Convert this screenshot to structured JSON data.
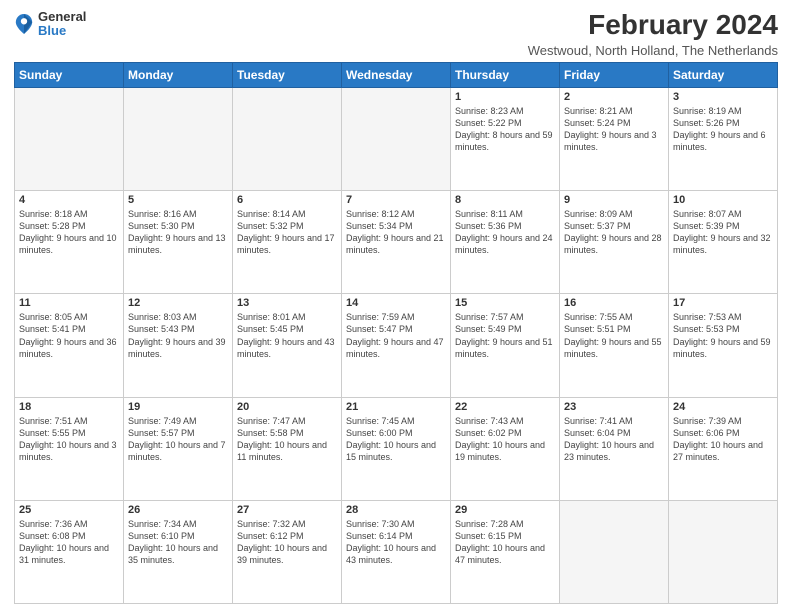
{
  "logo": {
    "general": "General",
    "blue": "Blue"
  },
  "title": "February 2024",
  "subtitle": "Westwoud, North Holland, The Netherlands",
  "days_header": [
    "Sunday",
    "Monday",
    "Tuesday",
    "Wednesday",
    "Thursday",
    "Friday",
    "Saturday"
  ],
  "weeks": [
    [
      {
        "day": "",
        "info": ""
      },
      {
        "day": "",
        "info": ""
      },
      {
        "day": "",
        "info": ""
      },
      {
        "day": "",
        "info": ""
      },
      {
        "day": "1",
        "info": "Sunrise: 8:23 AM\nSunset: 5:22 PM\nDaylight: 8 hours\nand 59 minutes."
      },
      {
        "day": "2",
        "info": "Sunrise: 8:21 AM\nSunset: 5:24 PM\nDaylight: 9 hours\nand 3 minutes."
      },
      {
        "day": "3",
        "info": "Sunrise: 8:19 AM\nSunset: 5:26 PM\nDaylight: 9 hours\nand 6 minutes."
      }
    ],
    [
      {
        "day": "4",
        "info": "Sunrise: 8:18 AM\nSunset: 5:28 PM\nDaylight: 9 hours\nand 10 minutes."
      },
      {
        "day": "5",
        "info": "Sunrise: 8:16 AM\nSunset: 5:30 PM\nDaylight: 9 hours\nand 13 minutes."
      },
      {
        "day": "6",
        "info": "Sunrise: 8:14 AM\nSunset: 5:32 PM\nDaylight: 9 hours\nand 17 minutes."
      },
      {
        "day": "7",
        "info": "Sunrise: 8:12 AM\nSunset: 5:34 PM\nDaylight: 9 hours\nand 21 minutes."
      },
      {
        "day": "8",
        "info": "Sunrise: 8:11 AM\nSunset: 5:36 PM\nDaylight: 9 hours\nand 24 minutes."
      },
      {
        "day": "9",
        "info": "Sunrise: 8:09 AM\nSunset: 5:37 PM\nDaylight: 9 hours\nand 28 minutes."
      },
      {
        "day": "10",
        "info": "Sunrise: 8:07 AM\nSunset: 5:39 PM\nDaylight: 9 hours\nand 32 minutes."
      }
    ],
    [
      {
        "day": "11",
        "info": "Sunrise: 8:05 AM\nSunset: 5:41 PM\nDaylight: 9 hours\nand 36 minutes."
      },
      {
        "day": "12",
        "info": "Sunrise: 8:03 AM\nSunset: 5:43 PM\nDaylight: 9 hours\nand 39 minutes."
      },
      {
        "day": "13",
        "info": "Sunrise: 8:01 AM\nSunset: 5:45 PM\nDaylight: 9 hours\nand 43 minutes."
      },
      {
        "day": "14",
        "info": "Sunrise: 7:59 AM\nSunset: 5:47 PM\nDaylight: 9 hours\nand 47 minutes."
      },
      {
        "day": "15",
        "info": "Sunrise: 7:57 AM\nSunset: 5:49 PM\nDaylight: 9 hours\nand 51 minutes."
      },
      {
        "day": "16",
        "info": "Sunrise: 7:55 AM\nSunset: 5:51 PM\nDaylight: 9 hours\nand 55 minutes."
      },
      {
        "day": "17",
        "info": "Sunrise: 7:53 AM\nSunset: 5:53 PM\nDaylight: 9 hours\nand 59 minutes."
      }
    ],
    [
      {
        "day": "18",
        "info": "Sunrise: 7:51 AM\nSunset: 5:55 PM\nDaylight: 10 hours\nand 3 minutes."
      },
      {
        "day": "19",
        "info": "Sunrise: 7:49 AM\nSunset: 5:57 PM\nDaylight: 10 hours\nand 7 minutes."
      },
      {
        "day": "20",
        "info": "Sunrise: 7:47 AM\nSunset: 5:58 PM\nDaylight: 10 hours\nand 11 minutes."
      },
      {
        "day": "21",
        "info": "Sunrise: 7:45 AM\nSunset: 6:00 PM\nDaylight: 10 hours\nand 15 minutes."
      },
      {
        "day": "22",
        "info": "Sunrise: 7:43 AM\nSunset: 6:02 PM\nDaylight: 10 hours\nand 19 minutes."
      },
      {
        "day": "23",
        "info": "Sunrise: 7:41 AM\nSunset: 6:04 PM\nDaylight: 10 hours\nand 23 minutes."
      },
      {
        "day": "24",
        "info": "Sunrise: 7:39 AM\nSunset: 6:06 PM\nDaylight: 10 hours\nand 27 minutes."
      }
    ],
    [
      {
        "day": "25",
        "info": "Sunrise: 7:36 AM\nSunset: 6:08 PM\nDaylight: 10 hours\nand 31 minutes."
      },
      {
        "day": "26",
        "info": "Sunrise: 7:34 AM\nSunset: 6:10 PM\nDaylight: 10 hours\nand 35 minutes."
      },
      {
        "day": "27",
        "info": "Sunrise: 7:32 AM\nSunset: 6:12 PM\nDaylight: 10 hours\nand 39 minutes."
      },
      {
        "day": "28",
        "info": "Sunrise: 7:30 AM\nSunset: 6:14 PM\nDaylight: 10 hours\nand 43 minutes."
      },
      {
        "day": "29",
        "info": "Sunrise: 7:28 AM\nSunset: 6:15 PM\nDaylight: 10 hours\nand 47 minutes."
      },
      {
        "day": "",
        "info": ""
      },
      {
        "day": "",
        "info": ""
      }
    ]
  ]
}
